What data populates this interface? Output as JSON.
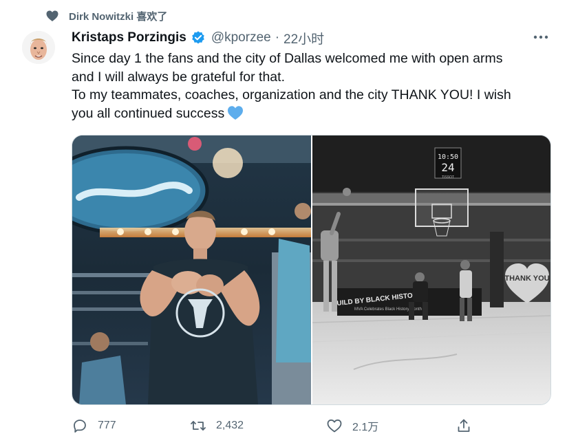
{
  "social_context": {
    "liked_by": "Dirk Nowitzki 喜欢了"
  },
  "tweet": {
    "author_name": "Kristaps Porzingis",
    "handle": "@kporzee",
    "separator": "·",
    "time": "22小时",
    "text_lines": [
      "Since day 1 the fans and the city of Dallas welcomed me with open arms",
      "and I will always be grateful for that.",
      "To my teammates, coaches, organization and the city THANK YOU! I wish",
      "you all continued success"
    ],
    "photo_right_texts": {
      "shot_clock_time": "10:50",
      "shot_clock_count": "24",
      "shot_clock_brand": "TISSOT",
      "heart_sign": "THANK YOU",
      "banner": "BUILD BY BLACK HISTORY",
      "banner_sub": "MVA Celebrates Black History Month"
    },
    "actions": {
      "reply_count": "777",
      "retweet_count": "2,432",
      "like_count": "2.1万"
    }
  },
  "colors": {
    "text_primary": "#0f1419",
    "text_secondary": "#536471",
    "verified": "#1d9bf0",
    "emoji_heart": "#5dadec"
  },
  "icons": [
    "heart-icon",
    "verified-badge-icon",
    "more-options-icon",
    "blue-heart-emoji",
    "reply-icon",
    "retweet-icon",
    "like-icon",
    "share-icon"
  ]
}
